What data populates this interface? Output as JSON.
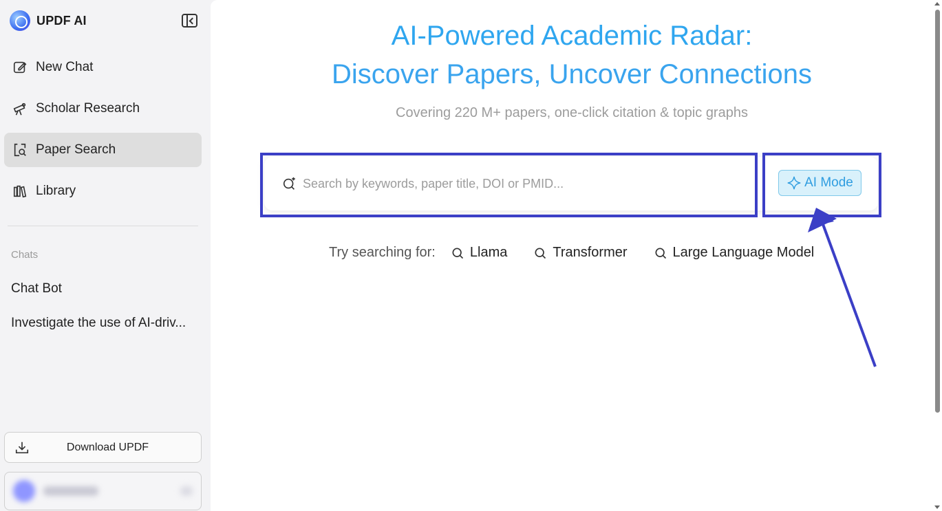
{
  "brand": {
    "name": "UPDF AI"
  },
  "sidebar": {
    "items": [
      {
        "label": "New Chat",
        "icon": "edit-icon"
      },
      {
        "label": "Scholar Research",
        "icon": "telescope-icon"
      },
      {
        "label": "Paper Search",
        "icon": "paper-search-icon",
        "active": true
      },
      {
        "label": "Library",
        "icon": "library-icon"
      }
    ],
    "chats_label": "Chats",
    "chats": [
      "Chat Bot",
      "Investigate the use of AI-driv..."
    ],
    "download_label": "Download UPDF"
  },
  "main": {
    "title_line1": "AI-Powered Academic Radar:",
    "title_line2": "Discover Papers, Uncover Connections",
    "subtitle": "Covering 220 M+ papers, one-click citation & topic graphs",
    "search": {
      "placeholder": "Search by keywords, paper title, DOI or PMID...",
      "value": ""
    },
    "ai_mode_label": "AI Mode",
    "suggestions_label": "Try searching for:",
    "suggestions": [
      "Llama",
      "Transformer",
      "Large Language Model"
    ]
  },
  "colors": {
    "accent": "#2fa6ef",
    "highlight": "#3b3fc6",
    "active_bg": "#dedede"
  }
}
